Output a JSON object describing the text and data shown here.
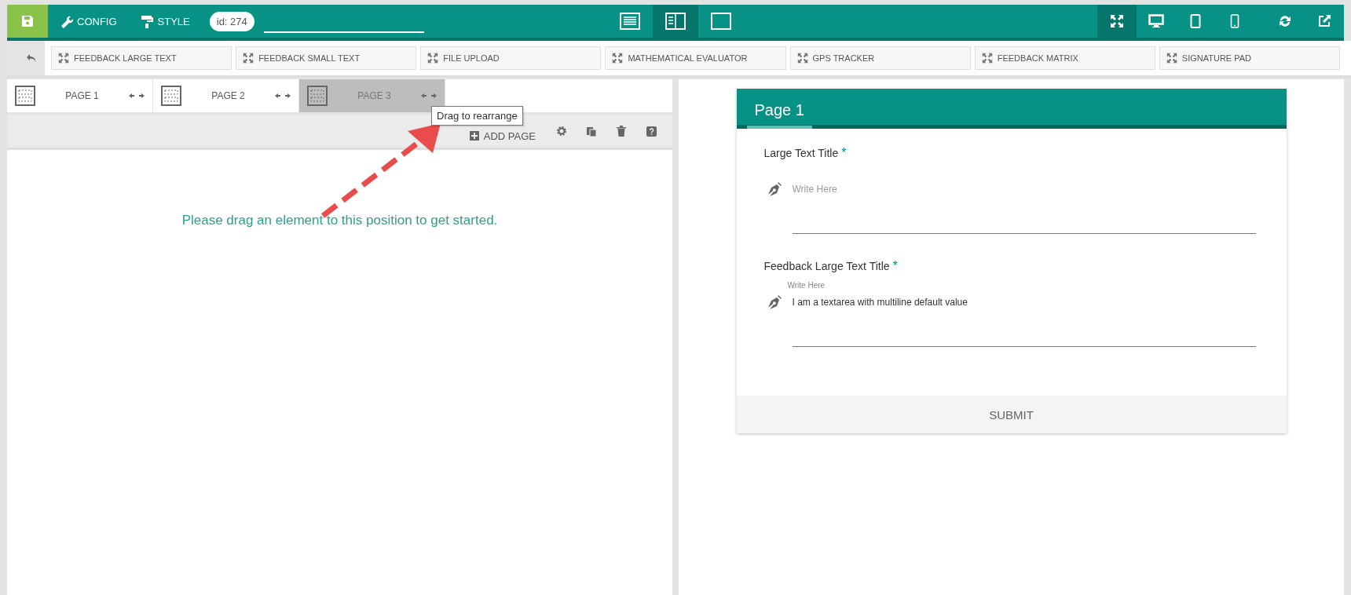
{
  "toolbar": {
    "buttons": [
      {
        "label": "CONFIG",
        "kind": "wrench"
      },
      {
        "label": "STYLE",
        "kind": "roller"
      }
    ],
    "id_badge": "id: 274",
    "view_modes": [
      {
        "kind": "list",
        "selected": false
      },
      {
        "kind": "split",
        "selected": true
      },
      {
        "kind": "blank",
        "selected": false
      }
    ],
    "devices": [
      {
        "kind": "fullscreen",
        "selected": true
      },
      {
        "kind": "desktop",
        "selected": false
      },
      {
        "kind": "tablet",
        "selected": false
      },
      {
        "kind": "phone",
        "selected": false
      }
    ]
  },
  "elements": [
    "FEEDBACK LARGE TEXT",
    "FEEDBACK SMALL TEXT",
    "FILE UPLOAD",
    "MATHEMATICAL EVALUATOR",
    "GPS TRACKER",
    "FEEDBACK MATRIX",
    "SIGNATURE PAD"
  ],
  "pages": [
    {
      "label": "PAGE 1",
      "selected": false
    },
    {
      "label": "PAGE 2",
      "selected": false
    },
    {
      "label": "PAGE 3",
      "selected": true
    }
  ],
  "tooltip": "Drag to rearrange",
  "actions": [
    {
      "kind": "add",
      "label": "ADD PAGE"
    },
    {
      "kind": "settings"
    },
    {
      "kind": "copy"
    },
    {
      "kind": "delete"
    },
    {
      "kind": "help"
    }
  ],
  "empty_message": "Please drag an element to this position to get started.",
  "form": {
    "title": "Page 1",
    "fields": [
      {
        "label": "Large Text Title",
        "required_mark": "*",
        "placeholder": "Write Here"
      },
      {
        "label": "Feedback Large Text Title",
        "required_mark": "*",
        "floating_label": "Write Here",
        "value": "I am a textarea with multiline default value"
      }
    ],
    "submit": "SUBMIT"
  }
}
